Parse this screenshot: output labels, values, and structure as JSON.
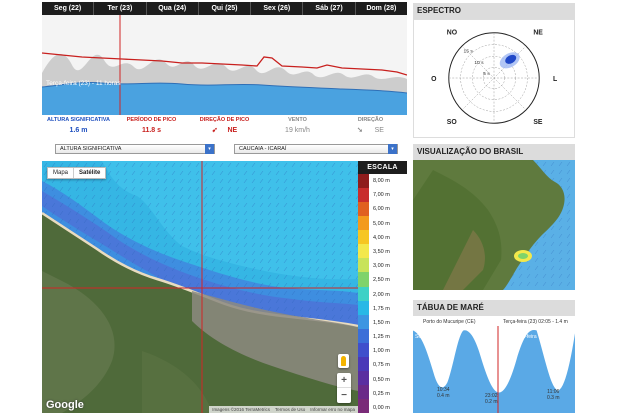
{
  "forecast": {
    "days": [
      "Seg (22)",
      "Ter (23)",
      "Qua (24)",
      "Qui (25)",
      "Sex (26)",
      "Sáb (27)",
      "Dom (28)"
    ],
    "now_label": "Terça-feira (23) - 11 horas",
    "metrics": [
      {
        "label": "ALTURA SIGNIFICATIVA",
        "value": "1.6 m",
        "color": "blue"
      },
      {
        "label": "PERÍODO DE PICO",
        "value": "11.8 s",
        "color": "red"
      },
      {
        "label": "DIREÇÃO DE PICO",
        "value": "NE",
        "color": "red"
      },
      {
        "label": "VENTO",
        "value": "19 km/h",
        "color": "grey"
      },
      {
        "label": "DIREÇÃO",
        "value": "SE",
        "color": "grey"
      }
    ]
  },
  "selects": {
    "variable": "ALTURA SIGNIFICATIVA",
    "location": "CAUCAIA - ICARAÍ"
  },
  "map": {
    "type_map": "Mapa",
    "type_satellite": "Satélite",
    "google": "Google",
    "attribution": [
      "Imagens ©2016 TerraMetrics",
      "Termos de Uso",
      "Informar erro no mapa"
    ],
    "zoom_in": "+",
    "zoom_out": "−"
  },
  "scale": {
    "title": "ESCALA",
    "ticks": [
      "8,00 m",
      "7,00 m",
      "6,00 m",
      "5,00 m",
      "4,00 m",
      "3,50 m",
      "3,00 m",
      "2,50 m",
      "2,00 m",
      "1,75 m",
      "1,50 m",
      "1,25 m",
      "1,00 m",
      "0,75 m",
      "0,50 m",
      "0,25 m",
      "0,00 m"
    ],
    "colors": [
      "#8f1d1d",
      "#c82d2d",
      "#e06020",
      "#f39a1c",
      "#f6c622",
      "#f3e84b",
      "#c8e35a",
      "#7fd36b",
      "#3ed1c6",
      "#28b8e6",
      "#3c95e2",
      "#3b6fd8",
      "#3f4fcc",
      "#4a38b8",
      "#5a2ea0",
      "#6a2a88",
      "#7a2b78"
    ]
  },
  "spectrum": {
    "title": "ESPECTRO",
    "dirs": [
      "NO",
      "NE",
      "O",
      "L",
      "SO",
      "SE"
    ],
    "rings": [
      "15 s",
      "10 s",
      "5 s"
    ]
  },
  "brazil": {
    "title": "VISUALIZAÇÃO DO BRASIL"
  },
  "tide": {
    "title": "TÁBUA DE MARÉ",
    "port": "Porto do Mucuripe (CE)",
    "now": "Terça-feira (23) 02:05 - 1.4 m",
    "side_left": "Segunda-feira",
    "side_right": "Terça-feira",
    "lows": [
      {
        "time": "10:34",
        "height": "0.4 m"
      },
      {
        "time": "23:02",
        "height": "0.2 m"
      },
      {
        "time": "11:06",
        "height": "0.3 m"
      }
    ]
  }
}
